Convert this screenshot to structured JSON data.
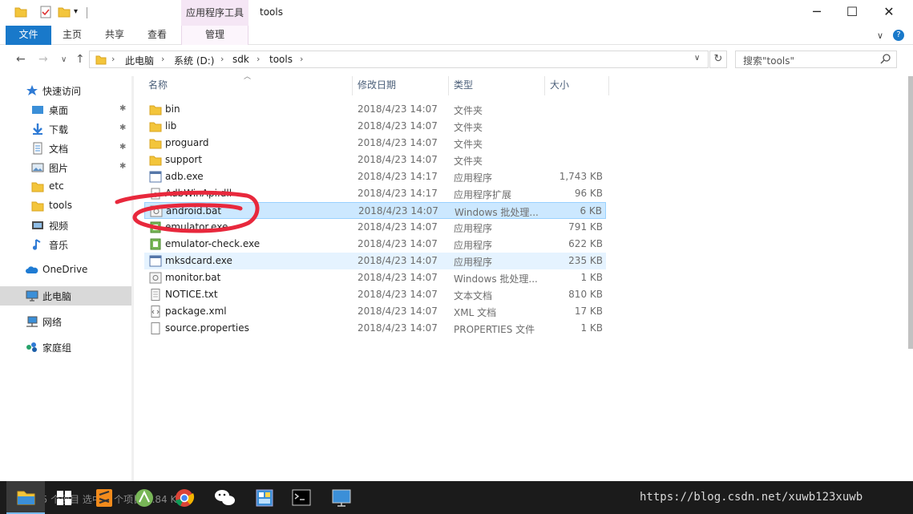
{
  "window": {
    "title": "tools",
    "contextual_tab_header": "应用程序工具",
    "minimize_glyph": "─",
    "maximize_glyph": "☐",
    "close_glyph": "✕"
  },
  "ribbon": {
    "tabs": [
      {
        "label": "文件",
        "icon": null
      },
      {
        "label": "主页"
      },
      {
        "label": "共享"
      },
      {
        "label": "查看"
      },
      {
        "label": "管理"
      }
    ],
    "collapse_glyph": "∨",
    "help_glyph": "?"
  },
  "address": {
    "back_glyph": "←",
    "forward_glyph": "→",
    "recent_glyph": "∨",
    "up_glyph": "↑",
    "crumbs": [
      "此电脑",
      "系统 (D:)",
      "sdk",
      "tools"
    ],
    "separator": "›",
    "refresh_glyph": "↻",
    "search_placeholder": "搜索\"tools\""
  },
  "nav": {
    "items": [
      {
        "label": "快速访问",
        "icon": "star-icon"
      },
      {
        "label": "桌面",
        "icon": "desktop-icon",
        "pinned": true
      },
      {
        "label": "下载",
        "icon": "download-icon",
        "pinned": true
      },
      {
        "label": "文档",
        "icon": "document-icon",
        "pinned": true
      },
      {
        "label": "图片",
        "icon": "picture-icon",
        "pinned": true
      },
      {
        "label": "etc",
        "icon": "folder-icon"
      },
      {
        "label": "tools",
        "icon": "folder-icon"
      },
      {
        "label": "视频",
        "icon": "video-icon"
      },
      {
        "label": "音乐",
        "icon": "music-icon"
      },
      {
        "label": "OneDrive",
        "icon": "cloud-icon"
      },
      {
        "label": "此电脑",
        "icon": "computer-icon"
      },
      {
        "label": "网络",
        "icon": "network-icon"
      },
      {
        "label": "家庭组",
        "icon": "homegroup-icon"
      }
    ],
    "pin_glyph": "📌"
  },
  "columns": {
    "name": "名称",
    "date": "修改日期",
    "type": "类型",
    "size": "大小"
  },
  "files": [
    {
      "name": "bin",
      "date": "2018/4/23 14:07",
      "type": "文件夹",
      "size": "",
      "icon": "folder-icon"
    },
    {
      "name": "lib",
      "date": "2018/4/23 14:07",
      "type": "文件夹",
      "size": "",
      "icon": "folder-icon"
    },
    {
      "name": "proguard",
      "date": "2018/4/23 14:07",
      "type": "文件夹",
      "size": "",
      "icon": "folder-icon"
    },
    {
      "name": "support",
      "date": "2018/4/23 14:07",
      "type": "文件夹",
      "size": "",
      "icon": "folder-icon"
    },
    {
      "name": "adb.exe",
      "date": "2018/4/23 14:17",
      "type": "应用程序",
      "size": "1,743 KB",
      "icon": "exe-icon"
    },
    {
      "name": "AdbWinApi.dll",
      "date": "2018/4/23 14:17",
      "type": "应用程序扩展",
      "size": "96 KB",
      "icon": "dll-icon"
    },
    {
      "name": "android.bat",
      "date": "2018/4/23 14:07",
      "type": "Windows 批处理...",
      "size": "6 KB",
      "icon": "bat-icon"
    },
    {
      "name": "emulator.exe",
      "date": "2018/4/23 14:07",
      "type": "应用程序",
      "size": "791 KB",
      "icon": "android-exe-icon"
    },
    {
      "name": "emulator-check.exe",
      "date": "2018/4/23 14:07",
      "type": "应用程序",
      "size": "622 KB",
      "icon": "android-exe-icon"
    },
    {
      "name": "mksdcard.exe",
      "date": "2018/4/23 14:07",
      "type": "应用程序",
      "size": "235 KB",
      "icon": "exe-icon"
    },
    {
      "name": "monitor.bat",
      "date": "2018/4/23 14:07",
      "type": "Windows 批处理...",
      "size": "1 KB",
      "icon": "bat-icon"
    },
    {
      "name": "NOTICE.txt",
      "date": "2018/4/23 14:07",
      "type": "文本文档",
      "size": "810 KB",
      "icon": "text-file-icon"
    },
    {
      "name": "package.xml",
      "date": "2018/4/23 14:07",
      "type": "XML 文档",
      "size": "17 KB",
      "icon": "xml-file-icon"
    },
    {
      "name": "source.properties",
      "date": "2018/4/23 14:07",
      "type": "PROPERTIES 文件",
      "size": "1 KB",
      "icon": "blank-file-icon"
    }
  ],
  "selected_file": "android.bat",
  "hovered_file": "mksdcard.exe",
  "status_ghost": "15 个项目  选中 1 个项目  5.84 KB",
  "taskbar": {
    "apps": [
      "file-explorer-icon",
      "store-icon",
      "sublime-icon",
      "android-studio-icon",
      "chrome-icon",
      "wechat-icon",
      "app-icon",
      "cmd-icon",
      "remote-desktop-icon"
    ]
  },
  "watermark": "https://blog.csdn.net/xuwb123xuwb",
  "colors": {
    "accent": "#1979ca",
    "selection": "#cce8ff",
    "annotation": "#e8283c",
    "contextual": "#f5e6f5"
  }
}
